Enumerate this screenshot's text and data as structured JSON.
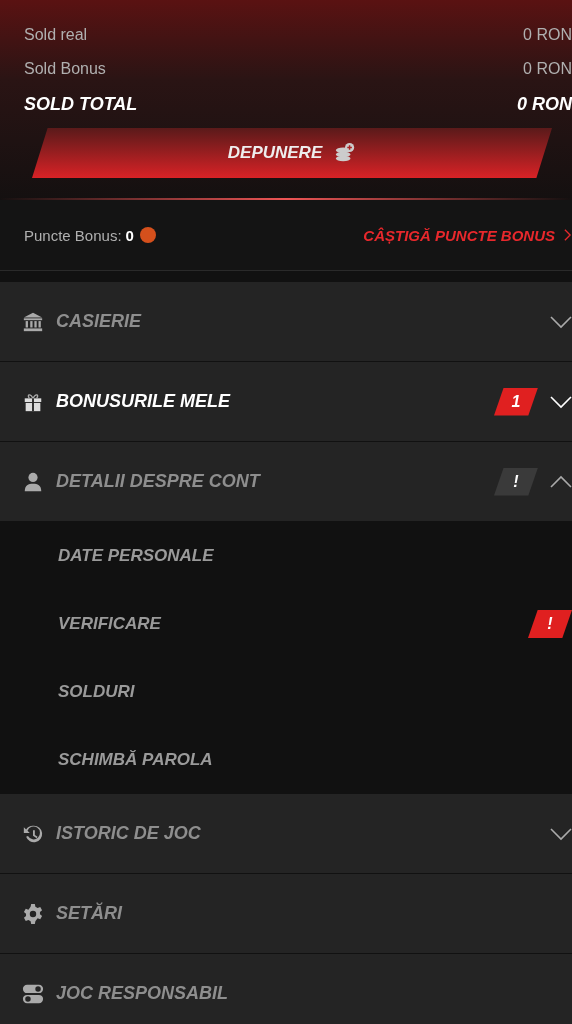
{
  "balances": [
    {
      "label": "Sold real",
      "value": "0 RON",
      "kind": "normal"
    },
    {
      "label": "Sold Bonus",
      "value": "0 RON",
      "kind": "normal"
    },
    {
      "label": "SOLD TOTAL",
      "value": "0 RON",
      "kind": "total"
    }
  ],
  "deposit_button": {
    "label": "DEPUNERE"
  },
  "bonus_points": {
    "label": "Puncte Bonus:",
    "value": "0",
    "link": "CÂȘTIGĂ PUNCTE BONUS"
  },
  "menu": [
    {
      "kind": "cashier",
      "label": "CASIERIE",
      "selected": false,
      "expanded": false
    },
    {
      "kind": "gift",
      "label": "BONUSURILE MELE",
      "selected": true,
      "expanded": false,
      "badge": {
        "text": "1",
        "color": "#e02020"
      }
    },
    {
      "kind": "account",
      "label": "DETALII DESPRE CONT",
      "selected": false,
      "expanded": true,
      "badge": {
        "text": "!",
        "color": "#3a3a3a"
      },
      "children": [
        {
          "label": "DATE PERSONALE"
        },
        {
          "label": "VERIFICARE",
          "badge": {
            "text": "!",
            "color": "#e02020"
          }
        },
        {
          "label": "SOLDURI"
        },
        {
          "label": "SCHIMBĂ PAROLA"
        }
      ]
    },
    {
      "kind": "history",
      "label": "ISTORIC DE JOC",
      "selected": false,
      "expanded": false
    },
    {
      "kind": "settings",
      "label": "SETĂRI",
      "selected": false
    },
    {
      "kind": "toggles",
      "label": "JOC RESPONSABIL",
      "selected": false
    }
  ]
}
